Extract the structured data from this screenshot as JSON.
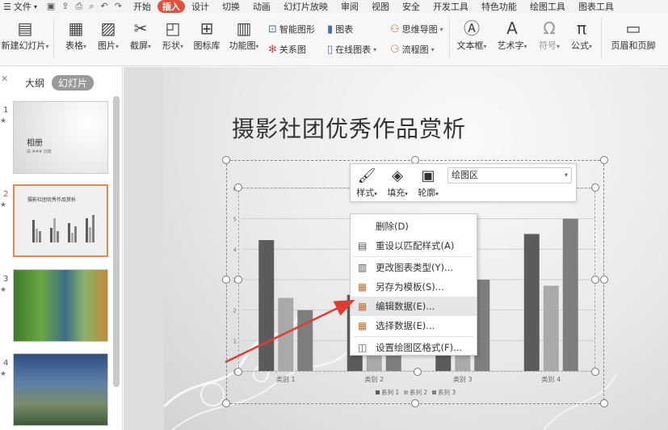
{
  "menubar": {
    "file_label": "文件",
    "tabs": [
      "开始",
      "插入",
      "设计",
      "切换",
      "动画",
      "幻灯片放映",
      "审阅",
      "视图",
      "安全",
      "开发工具",
      "特色功能",
      "绘图工具",
      "图表工具"
    ],
    "active_tab": "插入"
  },
  "ribbon": {
    "new_slide": "新建幻灯片",
    "table": "表格",
    "picture": "图片",
    "screenshot": "截屏",
    "shape": "形状",
    "icon_lib": "图标库",
    "func_chart": "功能图",
    "smart_art": "智能图形",
    "chart": "图表",
    "mindmap": "思维导图",
    "relation": "关系图",
    "online_chart": "在线图表",
    "flowchart": "流程图",
    "textbox": "文本框",
    "wordart": "艺术字",
    "symbol": "符号",
    "formula": "公式",
    "header_footer": "页眉和页脚"
  },
  "left_panel": {
    "outline_tab": "大纲",
    "slides_tab": "幻灯片",
    "slides": [
      {
        "num": "1",
        "title": "相册",
        "subtitle": "由 ### 创建"
      },
      {
        "num": "2",
        "title": "摄影社团优秀作品赏析"
      },
      {
        "num": "3"
      },
      {
        "num": "4"
      }
    ]
  },
  "slide": {
    "title": "摄影社团优秀作品赏析"
  },
  "mini_toolbar": {
    "style": "样式",
    "fill": "填充",
    "outline": "轮廓",
    "element_select": "绘图区"
  },
  "context_menu": {
    "items": [
      {
        "label": "删除(D)",
        "icon": "none"
      },
      {
        "label": "重设以匹配样式(A)",
        "icon": "reset-style-icon"
      },
      {
        "label": "更改图表类型(Y)...",
        "icon": "chart-type-icon"
      },
      {
        "label": "另存为模板(S)...",
        "icon": "save-template-icon"
      },
      {
        "label": "编辑数据(E)...",
        "icon": "edit-data-icon"
      },
      {
        "label": "选择数据(E)...",
        "icon": "select-data-icon"
      },
      {
        "label": "设置绘图区格式(F)...",
        "icon": "format-plot-icon"
      }
    ],
    "highlighted_index": 4
  },
  "chart_data": {
    "type": "bar",
    "categories": [
      "类别 1",
      "类别 2",
      "类别 3",
      "类别 4"
    ],
    "series": [
      {
        "name": "系列 1",
        "values": [
          4.3,
          2.5,
          3.5,
          4.5
        ],
        "color": "#5b5b5b"
      },
      {
        "name": "系列 2",
        "values": [
          2.4,
          4.4,
          1.8,
          2.8
        ],
        "color": "#a9a9a9"
      },
      {
        "name": "系列 3",
        "values": [
          2.0,
          2.0,
          3.0,
          5.0
        ],
        "color": "#7e7e7e"
      }
    ],
    "y_ticks": [
      "0",
      "1",
      "2",
      "3",
      "4",
      "5",
      "6"
    ],
    "ylim": [
      0,
      6
    ],
    "grid": true,
    "legend_position": "bottom"
  },
  "colors": {
    "accent": "#e0513e",
    "arrow": "#e03c31",
    "selected_thumb_border": "#e6884e"
  }
}
